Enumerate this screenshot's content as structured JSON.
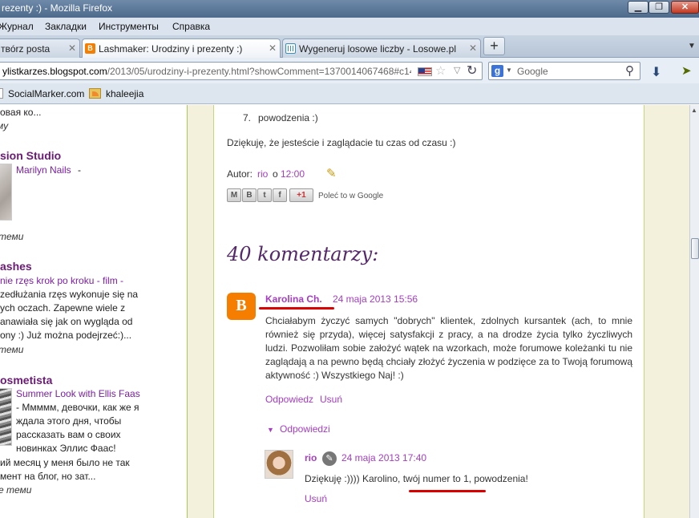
{
  "window": {
    "title": "rezenty :) - Mozilla Firefox",
    "minimize": "▁",
    "maximize": "❐",
    "close": "✕"
  },
  "menu": {
    "item1": "Журнал",
    "item2": "Закладки",
    "item3": "Инструменты",
    "item4": "Справка"
  },
  "tabs": [
    {
      "label": "твórz posta",
      "close": "✕"
    },
    {
      "label": "Lashmaker: Urodziny i prezenty :)",
      "close": "✕",
      "active": true
    },
    {
      "label": "Wygeneruj losowe liczby - Losowe.pl",
      "close": "✕"
    }
  ],
  "newtab": "+",
  "tablist": "▼",
  "navbar": {
    "url_host": "ylistkarzes.blogspot.com",
    "url_path": "/2013/05/urodziny-i-prezenty.html?showComment=1370014067468#c145",
    "search_engine": "g",
    "search_placeholder": "Google",
    "star": "☆",
    "drop": "▽",
    "reload": "↻",
    "magnifier": "⚲",
    "download": "⬇",
    "cursor": "➤"
  },
  "bookmarks": {
    "item1": "SocialMarker.com",
    "item2": "khaleejia"
  },
  "sidebar": {
    "line0": "овая ко...",
    "line1": "му",
    "section1_title": "sion Studio",
    "section1_link": "Marilyn Nails",
    "section1_dash": "-",
    "section1_time": "темu",
    "section2_title": "ashes",
    "section2_lines": [
      "nie rzęs krok po kroku - film -",
      "zedłużania rzęs wykonuje się na",
      "ych oczach. Zapewne wiele z",
      "anawiała się jak on wygląda od",
      "ony :) Już można podejrzeć:)..."
    ],
    "section2_time": "темu",
    "section3_title": "osmetista",
    "section3_link": "Summer Look with Ellis Faas",
    "section3_lines": [
      "- Ммммм, девочки, как же я",
      "ждала этого дня, чтобы",
      "рассказать вам о своих",
      "новинках Эллис Фаас!",
      "ий месяц у меня было не так",
      "мент на блог, но зат..."
    ],
    "section3_time": "е темu"
  },
  "post": {
    "list_item_number": "7.",
    "list_item_text": "powodzenia :)",
    "thanks": "Dziękuję, że jesteście i zaglądacie tu czas od czasu :)",
    "author_prefix": "Autor:",
    "author_name": "rio",
    "author_o": "o",
    "author_time": "12:00",
    "share_buttons": [
      "M",
      "B",
      "t",
      "f"
    ],
    "gplus": "+1",
    "recommend": "Poleć to w Google",
    "comments_title": "40 komentarzy:"
  },
  "comment1": {
    "author": "Karolina Ch.",
    "date": "24 maja 2013 15:56",
    "body": "Chciałabym życzyć samych \"dobrych\" klientek, zdolnych kursantek (ach, to mnie również się przyda), więcej satysfakcji z pracy, a na drodze życia tylko życzliwych ludzi. Pozwoliłam sobie założyć wątek na wzorkach, może forumowe koleżanki tu nie zaglądają a na pewno będą chciały złożyć życzenia w podzięce za to Twoją forumową aktywność :) Wszystkiego Naj! :)",
    "reply_link": "Odpowiedz",
    "delete_link": "Usuń",
    "replies_toggle": "Odpowiedzi"
  },
  "reply1": {
    "author": "rio",
    "date": "24 maja 2013 17:40",
    "body": "Dziękuję :)))) Karolino, twój numer to 1, powodzenia!",
    "delete_link": "Usuń"
  },
  "colors": {
    "link": "#a43dc0",
    "heading": "#55286b",
    "underline": "#d90000"
  }
}
